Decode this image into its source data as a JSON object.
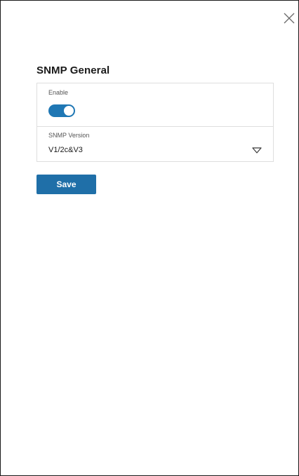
{
  "panel": {
    "close_icon": "close-icon"
  },
  "section": {
    "title": "SNMP General"
  },
  "fields": {
    "enable": {
      "label": "Enable",
      "value": true
    },
    "snmp_version": {
      "label": "SNMP Version",
      "value": "V1/2c&V3",
      "chevron_icon": "chevron-down-icon"
    }
  },
  "actions": {
    "save_label": "Save"
  },
  "colors": {
    "accent": "#1f6fa8",
    "toggle_on": "#1f77b4",
    "border": "#dedede"
  }
}
